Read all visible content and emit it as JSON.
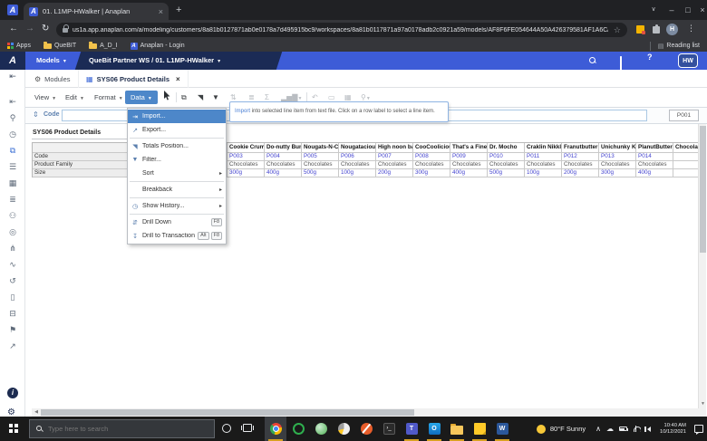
{
  "colors": {
    "anaplan_blue": "#3d5cd7",
    "anaplan_navy": "#1b2b55",
    "menu_highlight": "#4d87c9",
    "grid_link_blue": "#4343cf",
    "taskbar_underline": "#d7a021"
  },
  "browser": {
    "tab_title": "01. L1MP-HWalker | Anaplan",
    "url": "us1a.app.anaplan.com/a/modeling/customers/8a81b0127871ab0e0178a7d495915bc9/workspaces/8a81b0117871a97a0178adb2c0921a59/models/AF8F6FE054644A50A426379581AF1A6C/tabs/1...",
    "url_domain": "us1a.app.anaplan.com",
    "profile_initial": "H",
    "reading_list_label": "Reading list",
    "bookmarks": [
      {
        "label": "Apps",
        "icon": "apps-grid-icon"
      },
      {
        "label": "QueBIT",
        "icon": "folder-icon"
      },
      {
        "label": "A_D_I",
        "icon": "folder-icon"
      },
      {
        "label": "Anaplan - Login",
        "icon": "anaplan-logo-icon"
      }
    ]
  },
  "header": {
    "logo": "A",
    "models_label": "Models",
    "workspace_label": "QueBit Partner WS / 01. L1MP-HWalker",
    "avatar": "HW"
  },
  "tabbar": {
    "modules_label": "Modules",
    "active_tab": "SYS06 Product Details"
  },
  "toolbar": {
    "menus": [
      "View",
      "Edit",
      "Format",
      "Data"
    ],
    "active_menu": "Data"
  },
  "formula_bar": {
    "line_item": "Code",
    "input_value": "",
    "cell_value": "P001"
  },
  "data_menu": {
    "items": [
      {
        "label": "Import...",
        "icon": "import-icon",
        "glyph": "⇥",
        "highlight": true
      },
      {
        "label": "Export...",
        "icon": "export-icon",
        "glyph": "↗"
      },
      {
        "sep": true
      },
      {
        "label": "Totals Position...",
        "icon": "totals-position-icon",
        "glyph": "◥"
      },
      {
        "label": "Filter...",
        "icon": "filter-icon",
        "glyph": "▼"
      },
      {
        "label": "Sort",
        "submenu": true
      },
      {
        "sep": true
      },
      {
        "label": "Breakback",
        "submenu": true
      },
      {
        "sep": true
      },
      {
        "label": "Show History...",
        "icon": "history-icon",
        "glyph": "◷",
        "submenu": true
      },
      {
        "sep": true
      },
      {
        "label": "Drill Down",
        "icon": "drill-down-icon",
        "glyph": "⇵",
        "keys": [
          "F8"
        ]
      },
      {
        "label": "Drill to Transaction",
        "icon": "drill-to-transaction-icon",
        "glyph": "↧",
        "keys": [
          "Alt",
          "F8"
        ]
      }
    ]
  },
  "tooltip": {
    "link_word": "Import",
    "body": " into selected line item from text file. Click on a row label to select a line item."
  },
  "grid": {
    "title": "SYS06 Product Details",
    "row_headers": [
      "Code",
      "Product Family",
      "Size"
    ],
    "columns": [
      "Cookie Crumb",
      "Do-nutty Bunc",
      "Nougats-N-Cre",
      "Nougatacious",
      "High noon bar",
      "CooCoolicious",
      "That's a Fine H",
      "Dr. Mocho",
      "Craklin Nikklin",
      "Franutbutter K",
      "Unichunky Kri",
      "PlanutButter K",
      "Chocolate"
    ],
    "code_row": [
      "P003",
      "P004",
      "P005",
      "P006",
      "P007",
      "P008",
      "P009",
      "P010",
      "P011",
      "P012",
      "P013",
      "P014",
      ""
    ],
    "family_row": [
      "Chocolates",
      "Chocolates",
      "Chocolates",
      "Chocolates",
      "Chocolates",
      "Chocolates",
      "Chocolates",
      "Chocolates",
      "Chocolates",
      "Chocolates",
      "Chocolates",
      "Chocolates",
      ""
    ],
    "size_row": [
      "300g",
      "400g",
      "500g",
      "100g",
      "200g",
      "300g",
      "400g",
      "500g",
      "100g",
      "200g",
      "300g",
      "400g",
      ""
    ]
  },
  "sidebar": {
    "icons": [
      {
        "name": "collapse-panel-icon",
        "glyph": "⇤"
      },
      {
        "name": "search-icon",
        "glyph": "⚲"
      },
      {
        "name": "history-icon",
        "glyph": "◷"
      },
      {
        "name": "pages-icon",
        "glyph": "⧉",
        "active": true
      },
      {
        "name": "list-icon",
        "glyph": "☰"
      },
      {
        "name": "modules-icon",
        "glyph": "▦"
      },
      {
        "name": "line-items-icon",
        "glyph": "≣"
      },
      {
        "name": "users-icon",
        "glyph": "⚇"
      },
      {
        "name": "actions-icon",
        "glyph": "◎"
      },
      {
        "name": "connections-icon",
        "glyph": "⋔"
      },
      {
        "name": "attachment-icon",
        "glyph": "∿"
      },
      {
        "name": "restore-icon",
        "glyph": "↺"
      },
      {
        "name": "device-icon",
        "glyph": "▯"
      },
      {
        "name": "cards-icon",
        "glyph": "⊟"
      },
      {
        "name": "bookmark-icon",
        "glyph": "⚑"
      },
      {
        "name": "share-icon",
        "glyph": "↗"
      }
    ]
  },
  "taskbar": {
    "search_placeholder": "Type here to search",
    "apps": [
      {
        "name": "chrome",
        "icon_class": "icon-chrome",
        "active": true,
        "focused": true
      },
      {
        "name": "green-ring-app",
        "icon_class": "icon-ring"
      },
      {
        "name": "green-globe-app",
        "icon_class": "icon-globe"
      },
      {
        "name": "pie-chart-app",
        "icon_class": "icon-pie"
      },
      {
        "name": "orange-marker-app",
        "icon_class": "icon-marker"
      },
      {
        "name": "terminal-app",
        "icon_class": "icon-terminal",
        "letter": "›_"
      },
      {
        "name": "teams",
        "icon_class": "icon-teams",
        "letter": "T",
        "active": true
      },
      {
        "name": "outlook",
        "icon_class": "icon-outlook",
        "letter": "O",
        "active": true
      },
      {
        "name": "file-explorer",
        "icon_class": "icon-folder2",
        "active": true
      },
      {
        "name": "sticky-notes",
        "icon_class": "icon-notes",
        "active": true
      },
      {
        "name": "word",
        "icon_class": "icon-word",
        "letter": "W",
        "active": true
      }
    ],
    "weather_label": "80°F Sunny",
    "time": "10:40 AM",
    "date": "10/12/2021"
  }
}
